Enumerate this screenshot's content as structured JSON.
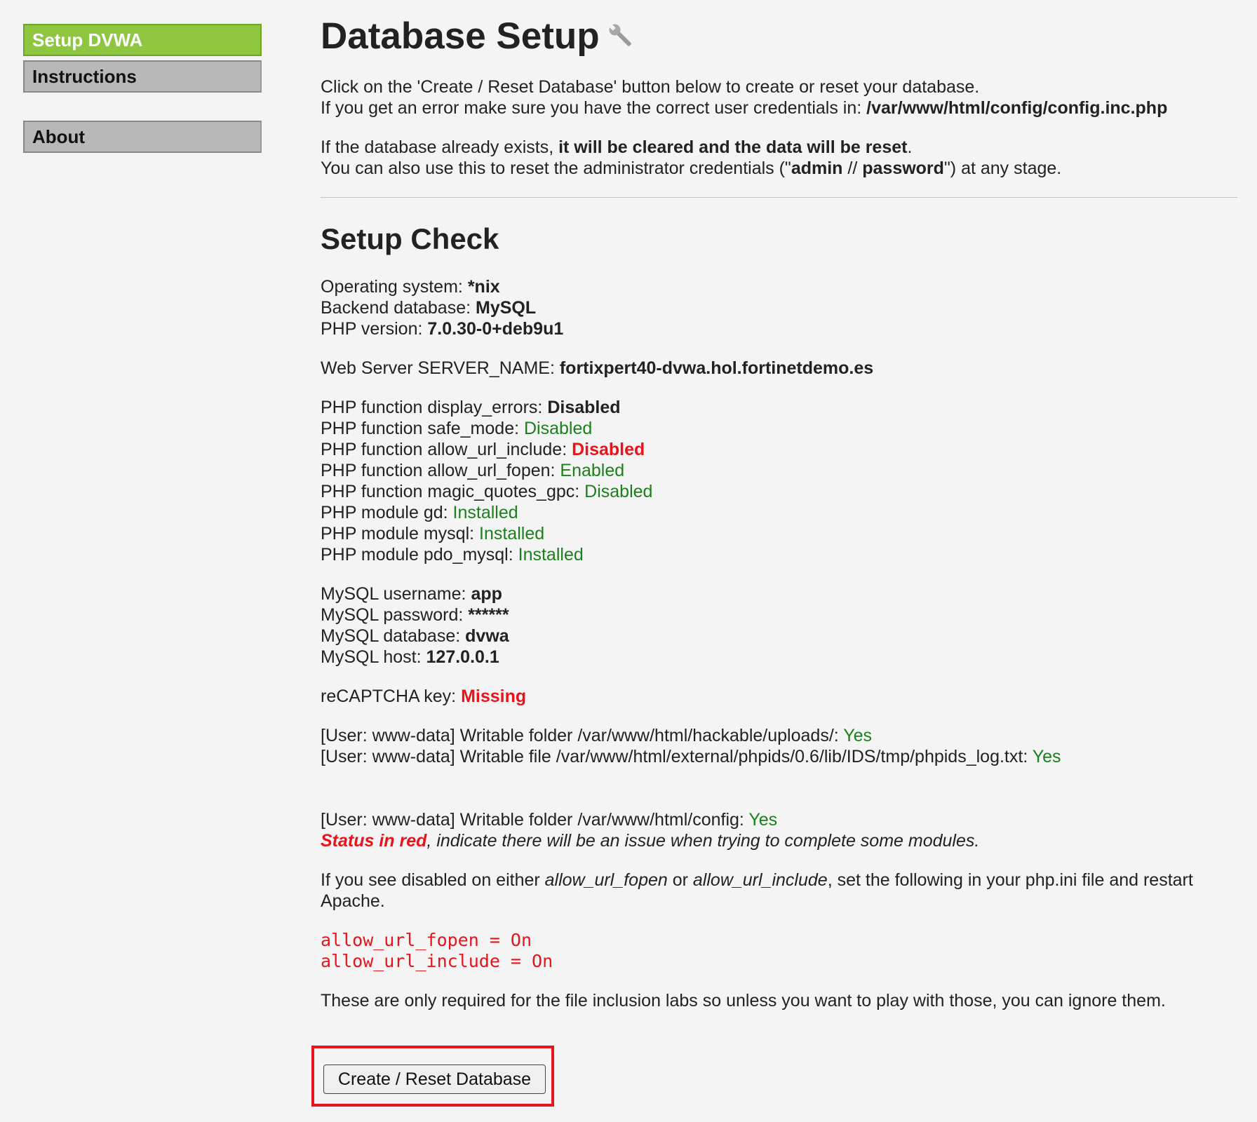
{
  "sidebar": {
    "items": [
      {
        "label": "Setup DVWA"
      },
      {
        "label": "Instructions"
      },
      {
        "label": "About"
      }
    ]
  },
  "header": {
    "title": "Database Setup"
  },
  "intro": {
    "line1": "Click on the 'Create / Reset Database' button below to create or reset your database.",
    "line2_prefix": "If you get an error make sure you have the correct user credentials in: ",
    "line2_path": "/var/www/html/config/config.inc.php",
    "line3_prefix": "If the database already exists, ",
    "line3_bold": "it will be cleared and the data will be reset",
    "line3_suffix": ".",
    "line4_prefix": "You can also use this to reset the administrator credentials (\"",
    "line4_user": "admin",
    "line4_sep": " // ",
    "line4_pass": "password",
    "line4_suffix": "\") at any stage."
  },
  "setup_check": {
    "title": "Setup Check",
    "os_label": "Operating system: ",
    "os_value": "*nix",
    "db_label": "Backend database: ",
    "db_value": "MySQL",
    "php_label": "PHP version: ",
    "php_value": "7.0.30-0+deb9u1",
    "server_label": "Web Server SERVER_NAME: ",
    "server_value": "fortixpert40-dvwa.hol.fortinetdemo.es",
    "functions": [
      {
        "label": "PHP function display_errors: ",
        "value": "Disabled"
      },
      {
        "label": "PHP function safe_mode: ",
        "value": "Disabled"
      },
      {
        "label": "PHP function allow_url_include: ",
        "value": "Disabled"
      },
      {
        "label": "PHP function allow_url_fopen: ",
        "value": "Enabled"
      },
      {
        "label": "PHP function magic_quotes_gpc: ",
        "value": "Disabled"
      },
      {
        "label": "PHP module gd: ",
        "value": "Installed"
      },
      {
        "label": "PHP module mysql: ",
        "value": "Installed"
      },
      {
        "label": "PHP module pdo_mysql: ",
        "value": "Installed"
      }
    ],
    "mysql": [
      {
        "label": "MySQL username: ",
        "value": "app"
      },
      {
        "label": "MySQL password: ",
        "value": "******"
      },
      {
        "label": "MySQL database: ",
        "value": "dvwa"
      },
      {
        "label": "MySQL host: ",
        "value": "127.0.0.1"
      }
    ],
    "recaptcha_label": "reCAPTCHA key: ",
    "recaptcha_value": "Missing",
    "writable": [
      {
        "label": "[User: www-data] Writable folder /var/www/html/hackable/uploads/: ",
        "value": "Yes"
      },
      {
        "label": "[User: www-data] Writable file /var/www/html/external/phpids/0.6/lib/IDS/tmp/phpids_log.txt: ",
        "value": "Yes"
      }
    ],
    "config_writable_label": "[User: www-data] Writable folder /var/www/html/config: ",
    "config_writable_value": "Yes",
    "status_red": "Status in red",
    "status_note": ", indicate there will be an issue when trying to complete some modules.",
    "disabled_note_1": "If you see disabled on either ",
    "disabled_note_fopen": "allow_url_fopen",
    "disabled_note_or": " or ",
    "disabled_note_include": "allow_url_include",
    "disabled_note_2": ", set the following in your php.ini file and restart Apache.",
    "code_line1": "allow_url_fopen = On",
    "code_line2": "allow_url_include = On",
    "final_note": "These are only required for the file inclusion labs so unless you want to play with those, you can ignore them."
  },
  "actions": {
    "create_reset_label": "Create / Reset Database"
  },
  "colors": {
    "ok": "#1b7f1b",
    "bad": "#e8141b",
    "active_menu": "#8ec63f",
    "menu": "#b8b8b8"
  }
}
